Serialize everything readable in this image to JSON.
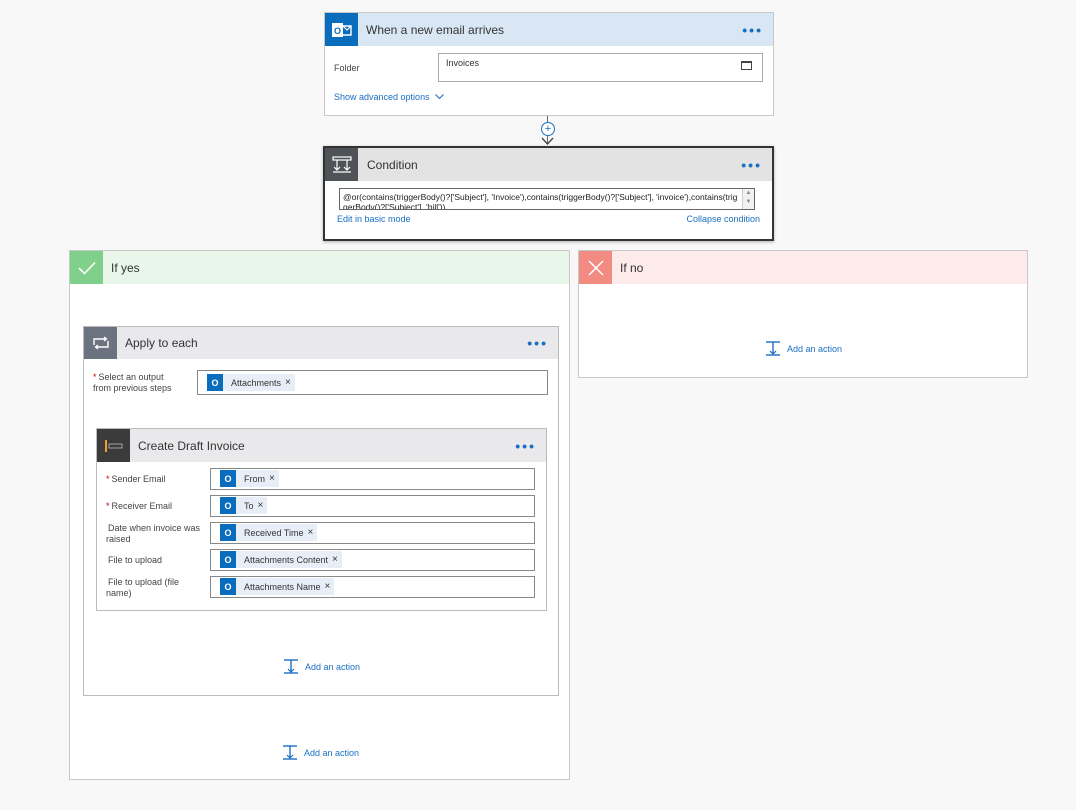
{
  "trigger": {
    "title": "When a new email arrives",
    "folder_label": "Folder",
    "folder_value": "Invoices",
    "advanced_link": "Show advanced options"
  },
  "condition": {
    "title": "Condition",
    "expression": "@or(contains(triggerBody()?['Subject'], 'Invoice'),contains(triggerBody()?['Subject'], 'invoice'),contains(triggerBody()?['Subject'], 'bill'))",
    "basic_mode_link": "Edit in basic mode",
    "collapse_link": "Collapse condition"
  },
  "if_yes": {
    "title": "If yes",
    "add_action": "Add an action"
  },
  "if_no": {
    "title": "If no",
    "add_action": "Add an action"
  },
  "apply_each": {
    "title": "Apply to each",
    "select_label": "Select an output from previous steps",
    "token": "Attachments",
    "add_action": "Add an action"
  },
  "draft_invoice": {
    "title": "Create Draft Invoice",
    "fields": [
      {
        "label": "Sender Email",
        "required": "*",
        "token": "From"
      },
      {
        "label": "Receiver Email",
        "required": "*",
        "token": "To"
      },
      {
        "label": "Date when invoice was raised",
        "required": "",
        "token": "Received Time"
      },
      {
        "label": "File to upload",
        "required": "",
        "token": "Attachments Content"
      },
      {
        "label": "File to upload (file name)",
        "required": "",
        "token": "Attachments Name"
      }
    ]
  },
  "icons": {
    "outlook": "outlook-icon",
    "condition": "condition-icon",
    "check": "check-icon",
    "cross": "cross-icon",
    "loop": "loop-icon",
    "invoice_app": "invoice-app-icon"
  },
  "colors": {
    "trigger_header": "#d9e7f5",
    "outlook_blue": "#0a6cbc",
    "condition_header": "#e3e3e3",
    "condition_icon_bg": "#4f5257",
    "yes_header": "#e9f6ea",
    "yes_icon_bg": "#7fd08a",
    "no_header": "#fdebeb",
    "no_icon_bg": "#f28b82",
    "apply_header": "#e9e9ec",
    "apply_icon_bg": "#6c7380",
    "link_blue": "#1a6fc2"
  }
}
